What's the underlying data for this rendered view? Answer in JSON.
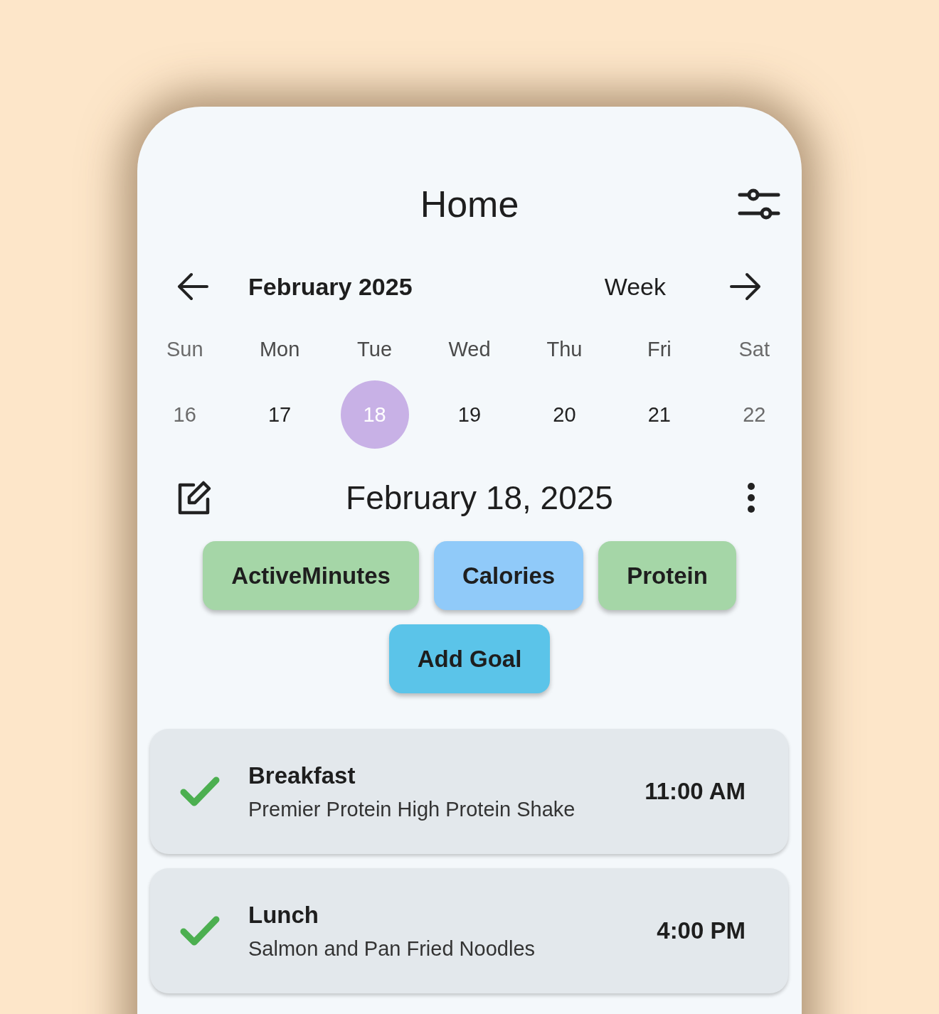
{
  "header": {
    "title": "Home"
  },
  "calendar": {
    "month": "February 2025",
    "view": "Week",
    "days": [
      {
        "name": "Sun",
        "date": "16",
        "weekend": true,
        "selected": false
      },
      {
        "name": "Mon",
        "date": "17",
        "weekend": false,
        "selected": false
      },
      {
        "name": "Tue",
        "date": "18",
        "weekend": false,
        "selected": true
      },
      {
        "name": "Wed",
        "date": "19",
        "weekend": false,
        "selected": false
      },
      {
        "name": "Thu",
        "date": "20",
        "weekend": false,
        "selected": false
      },
      {
        "name": "Fri",
        "date": "21",
        "weekend": false,
        "selected": false
      },
      {
        "name": "Sat",
        "date": "22",
        "weekend": true,
        "selected": false
      }
    ]
  },
  "day": {
    "date": "February 18, 2025"
  },
  "goals": [
    {
      "label": "ActiveMinutes",
      "color": "#a5d6a7"
    },
    {
      "label": "Calories",
      "color": "#90caf9"
    },
    {
      "label": "Protein",
      "color": "#a5d6a7"
    }
  ],
  "add_goal": "Add Goal",
  "meals": [
    {
      "title": "Breakfast",
      "description": "Premier Protein High Protein Shake",
      "time": "11:00 AM",
      "done": true
    },
    {
      "title": "Lunch",
      "description": "Salmon and Pan Fried Noodles",
      "time": "4:00 PM",
      "done": true
    }
  ]
}
